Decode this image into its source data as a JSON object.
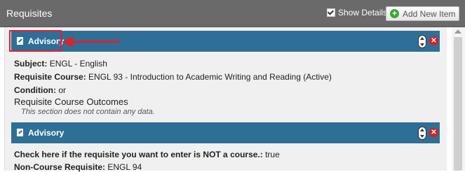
{
  "header": {
    "title": "Requisites",
    "show_details_label": "Show Details",
    "add_button_label": "Add New Item"
  },
  "items": [
    {
      "title": "Advisory",
      "fields": [
        {
          "label": "Subject:",
          "value": "ENGL - English"
        },
        {
          "label": "Requisite Course:",
          "value": "ENGL 93 - Introduction to Academic Writing and Reading (Active)"
        },
        {
          "label": "Condition:",
          "value": "or"
        }
      ],
      "section_title": "Requisite Course Outcomes",
      "section_empty": "This section does not contain any data."
    },
    {
      "title": "Advisory",
      "fields": [
        {
          "label": "Check here if the requisite you want to enter is NOT a course.:",
          "value": "true"
        },
        {
          "label": "Non-Course Requisite:",
          "value": "ENGL 94"
        }
      ]
    }
  ],
  "colors": {
    "header_bg": "#6a6a6a",
    "item_bar": "#2e6f97",
    "annotation": "#e0202a"
  }
}
